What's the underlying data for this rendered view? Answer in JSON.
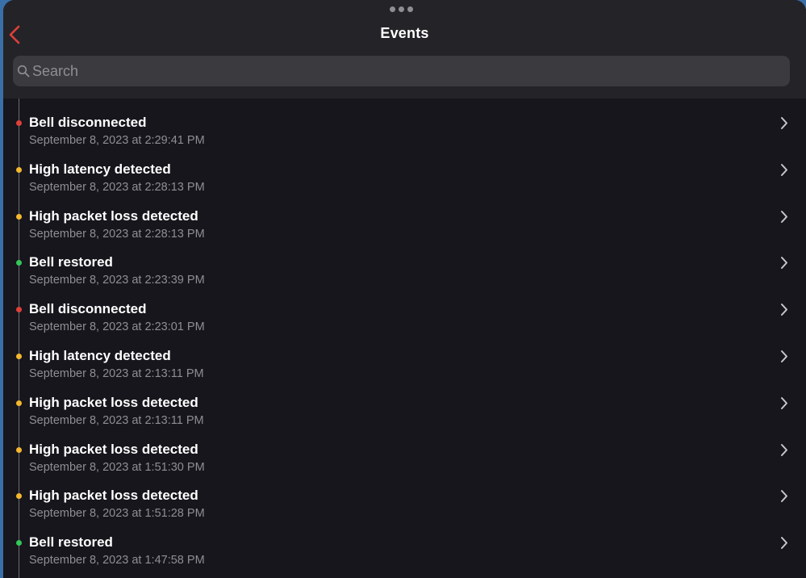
{
  "header": {
    "title": "Events"
  },
  "search": {
    "placeholder": "Search",
    "value": ""
  },
  "colors": {
    "disconnected": "#e0403a",
    "warning": "#f5b82e",
    "restored": "#34c759",
    "back": "#e0403a"
  },
  "icons": {
    "back": "chevron-left-icon",
    "search": "magnifying-glass-icon",
    "row": "chevron-right-icon",
    "more": "more-dots-icon"
  },
  "events": [
    {
      "title": "Bell disconnected",
      "time": "September 8, 2023 at 2:29:41 PM",
      "status": "disconnected"
    },
    {
      "title": "High latency detected",
      "time": "September 8, 2023 at 2:28:13 PM",
      "status": "warning"
    },
    {
      "title": "High packet loss detected",
      "time": "September 8, 2023 at 2:28:13 PM",
      "status": "warning"
    },
    {
      "title": "Bell restored",
      "time": "September 8, 2023 at 2:23:39 PM",
      "status": "restored"
    },
    {
      "title": "Bell disconnected",
      "time": "September 8, 2023 at 2:23:01 PM",
      "status": "disconnected"
    },
    {
      "title": "High latency detected",
      "time": "September 8, 2023 at 2:13:11 PM",
      "status": "warning"
    },
    {
      "title": "High packet loss detected",
      "time": "September 8, 2023 at 2:13:11 PM",
      "status": "warning"
    },
    {
      "title": "High packet loss detected",
      "time": "September 8, 2023 at 1:51:30 PM",
      "status": "warning"
    },
    {
      "title": "High packet loss detected",
      "time": "September 8, 2023 at 1:51:28 PM",
      "status": "warning"
    },
    {
      "title": "Bell restored",
      "time": "September 8, 2023 at 1:47:58 PM",
      "status": "restored"
    }
  ]
}
